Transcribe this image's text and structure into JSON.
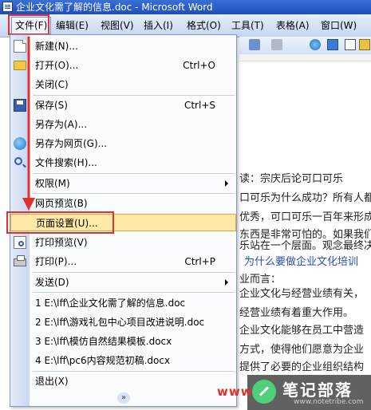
{
  "window": {
    "title": "企业文化需了解的信息.doc - Microsoft Word"
  },
  "menubar": {
    "items": [
      {
        "label": "文件(F)"
      },
      {
        "label": "编辑(E)"
      },
      {
        "label": "视图(V)"
      },
      {
        "label": "插入(I)"
      },
      {
        "label": "格式(O)"
      },
      {
        "label": "工具(T)"
      },
      {
        "label": "表格(A)"
      },
      {
        "label": "窗口(W)"
      }
    ]
  },
  "file_menu": {
    "items": [
      {
        "label": "新建(N)...",
        "shortcut": "",
        "icon": "new-document-icon"
      },
      {
        "label": "打开(O)...",
        "shortcut": "Ctrl+O",
        "icon": "folder-icon"
      },
      {
        "label": "关闭(C)",
        "shortcut": ""
      },
      {
        "label": "保存(S)",
        "shortcut": "Ctrl+S",
        "icon": "save-icon"
      },
      {
        "label": "另存为(A)...",
        "shortcut": ""
      },
      {
        "label": "另存为网页(G)...",
        "shortcut": "",
        "icon": "globe-icon"
      },
      {
        "label": "文件搜索(H)...",
        "shortcut": "",
        "icon": "search-icon"
      },
      {
        "label": "权限(M)",
        "shortcut": "",
        "submenu": true
      },
      {
        "label": "网页预览(B)",
        "shortcut": ""
      },
      {
        "label": "页面设置(U)...",
        "shortcut": "",
        "highlighted": true
      },
      {
        "label": "打印预览(V)",
        "shortcut": "",
        "icon": "print-preview-icon"
      },
      {
        "label": "打印(P)...",
        "shortcut": "Ctrl+P",
        "icon": "printer-icon"
      },
      {
        "label": "发送(D)",
        "shortcut": "",
        "submenu": true
      },
      {
        "label": "1 E:\\lff\\企业文化需了解的信息.doc",
        "shortcut": ""
      },
      {
        "label": "2 E:\\lff\\游戏礼包中心项目改进说明.doc",
        "shortcut": ""
      },
      {
        "label": "3 E:\\lff\\模仿自然结果模板.docx",
        "shortcut": ""
      },
      {
        "label": "4 E:\\lff\\pc6内容规范初稿.docx",
        "shortcut": ""
      },
      {
        "label": "退出(X)",
        "shortcut": ""
      }
    ],
    "expand": "»"
  },
  "document": {
    "lines": [
      "读：宗庆后论可口可乐",
      "口可乐为什么成功？所有人都",
      "优秀，可口可乐一百年来形成",
      "东西是非常可怕的。如果我们",
      "乐站在一个层面。观念最终决",
      "为什么要做企业文化培训",
      "业而言：",
      "企业文化与经营业绩有关，",
      "经营业绩有着重大作用。",
      "企业文化能够在员工中营造",
      "方式，使得他们愿意为企业",
      "提供了必要的企业组织结构"
    ]
  },
  "watermark": {
    "prefix": "www",
    "name": "笔记部落",
    "url": "www.notetribe.com"
  },
  "colors": {
    "highlight": "#ffe9a8",
    "annotation": "#e03030",
    "titlebar": "#2a5cc8"
  }
}
